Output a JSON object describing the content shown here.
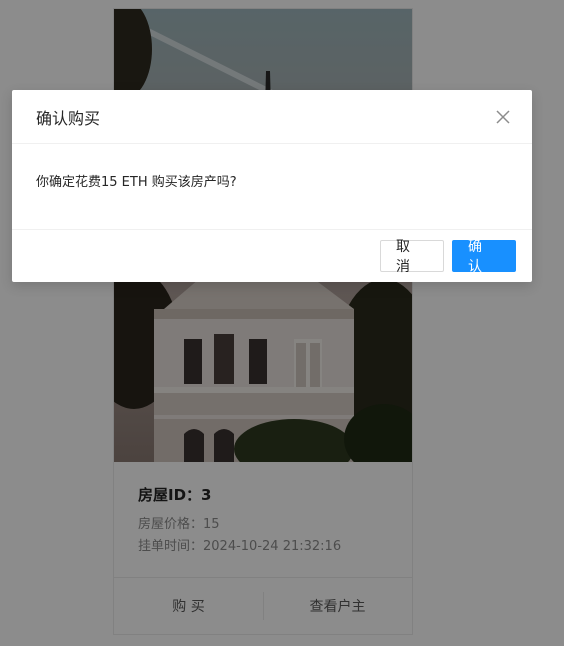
{
  "card": {
    "title_label": "房屋ID：",
    "house_id": "3",
    "price_label": "房屋价格：",
    "price_value": "15",
    "listed_label": "挂单时间：",
    "listed_value": "2024-10-24 21:32:16",
    "buy_label": "购 买",
    "view_owner_label": "查看户主"
  },
  "modal": {
    "title": "确认购买",
    "message": "你确定花费15 ETH 购买该房产吗?",
    "cancel_label": "取 消",
    "confirm_label": "确 认"
  },
  "icons": {
    "close": "close-icon",
    "cover": "house-photo"
  },
  "colors": {
    "primary": "#1890ff",
    "mask": "rgba(0,0,0,0.45)"
  }
}
